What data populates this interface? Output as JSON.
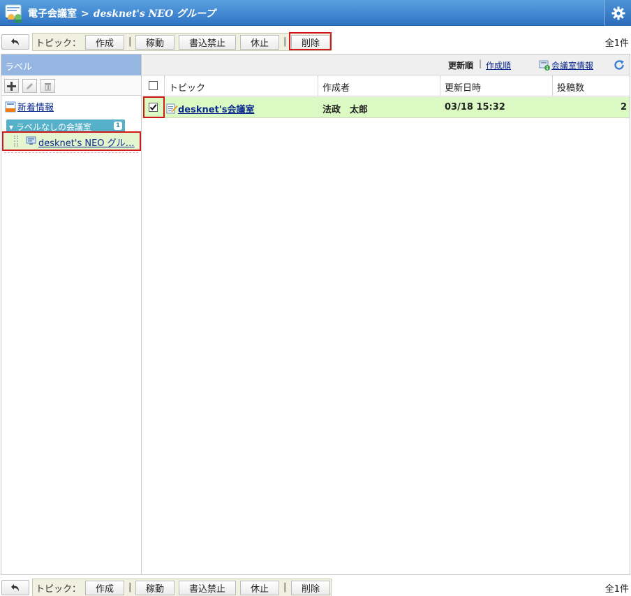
{
  "header": {
    "app_name": "電子会議室",
    "separator": ">",
    "group_name": "desknet's NEO グループ"
  },
  "toolbar": {
    "label": "トピック：",
    "create": "作成",
    "operate": "稼動",
    "readonly": "書込禁止",
    "pause": "休止",
    "delete": "削除",
    "pipe": "|",
    "count": "全1件"
  },
  "sidebar": {
    "heading": "ラベル",
    "new_info": "新着情報",
    "label_group": "ラベルなしの会議室",
    "label_group_count": "1",
    "room_name": "desknet's NEO グル…"
  },
  "sort": {
    "by_update": "更新順",
    "separator": "|",
    "by_create": "作成順",
    "room_info": "会議室情報"
  },
  "table": {
    "columns": [
      "トピック",
      "作成者",
      "更新日時",
      "投稿数"
    ],
    "rows": [
      {
        "topic": "desknet's会議室",
        "author": "法政　太郎",
        "updated": "03/18 15:32",
        "posts": "2",
        "checked": true
      }
    ]
  },
  "colors": {
    "highlight": "#d11a1a",
    "header_blue": "#3d84cf",
    "selected_row": "#dbf9c2"
  }
}
